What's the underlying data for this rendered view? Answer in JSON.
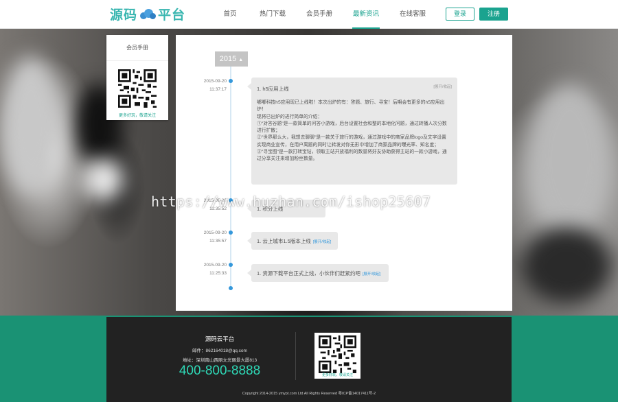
{
  "header": {
    "logo_text_1": "源码",
    "logo_text_2": "平台",
    "nav": [
      {
        "label": "首页"
      },
      {
        "label": "热门下载"
      },
      {
        "label": "会员手册"
      },
      {
        "label": "最新资讯"
      },
      {
        "label": "在线客服"
      }
    ],
    "active_nav": "最新资讯",
    "login_label": "登录",
    "register_label": "注册"
  },
  "sidebar": {
    "title": "会员手册",
    "qr_caption": "更多好玩，敬请关注"
  },
  "timeline": {
    "year": "2015",
    "entries": [
      {
        "date": "2015-09-20",
        "time": "11:37:17",
        "title": "1. h5应用上线",
        "tag": "[展开/收起]",
        "body": [
          "嘟嘟科技h5应用现已上线啦！本次出炉的有：答题、旅行、寻宝！后期会有更多的h5应用出炉！",
          "现将已出炉的进行简单的介绍：",
          "①\"对答谷题\"是一款简单的问答小游戏，后台设置社会和整的本地化问题，通过转播人次分数进行扩散；",
          "②\"世界那么大，我想去聊聊\"是一款关于旅行的游戏，通过游戏中的商家品牌logo及文字设置实现商业宣传，在用户离题的同时让转发对你无形中增加了商家品牌的曝光率、知名度；",
          "③\"寻宝图\"是一款打转宝钻，领取主站开放福利的数量将好友协助获得主站的一款小游戏，通过分享关注来增加粉丝数量。"
        ]
      },
      {
        "date": "2015-09-20",
        "time": "11:35:52",
        "title": "1. 积分上线",
        "tag": ""
      },
      {
        "date": "2015-09-20",
        "time": "11:35:57",
        "title": "1. 云上城市1.5版本上线",
        "tag": "[展开/收起]"
      },
      {
        "date": "2015-09-20",
        "time": "11:25:33",
        "title": "1. 资源下载平台正式上线，小伙伴们赶紧约吧",
        "tag": "[展开/收起]"
      }
    ]
  },
  "watermark": "https://www.huzhan.com/ishop25607",
  "footer": {
    "brand": "源码云平台",
    "email": "邮件：862164018@qq.com",
    "address": "地址：深圳南山西丽文光丽景大厦813",
    "phone": "400-800-8888",
    "qr_caption": "更多好玩，敬请关注",
    "copyright": "Copyright 2014-2015 ymypt.com Ltd All Rights Reserved 粤ICP备14017411号-2"
  },
  "colors": {
    "accent": "#1aa38f",
    "timeline_dot": "#3498db",
    "footer_band": "#1a9274",
    "footer_panel": "#222222",
    "phone": "#2ed8b6"
  }
}
